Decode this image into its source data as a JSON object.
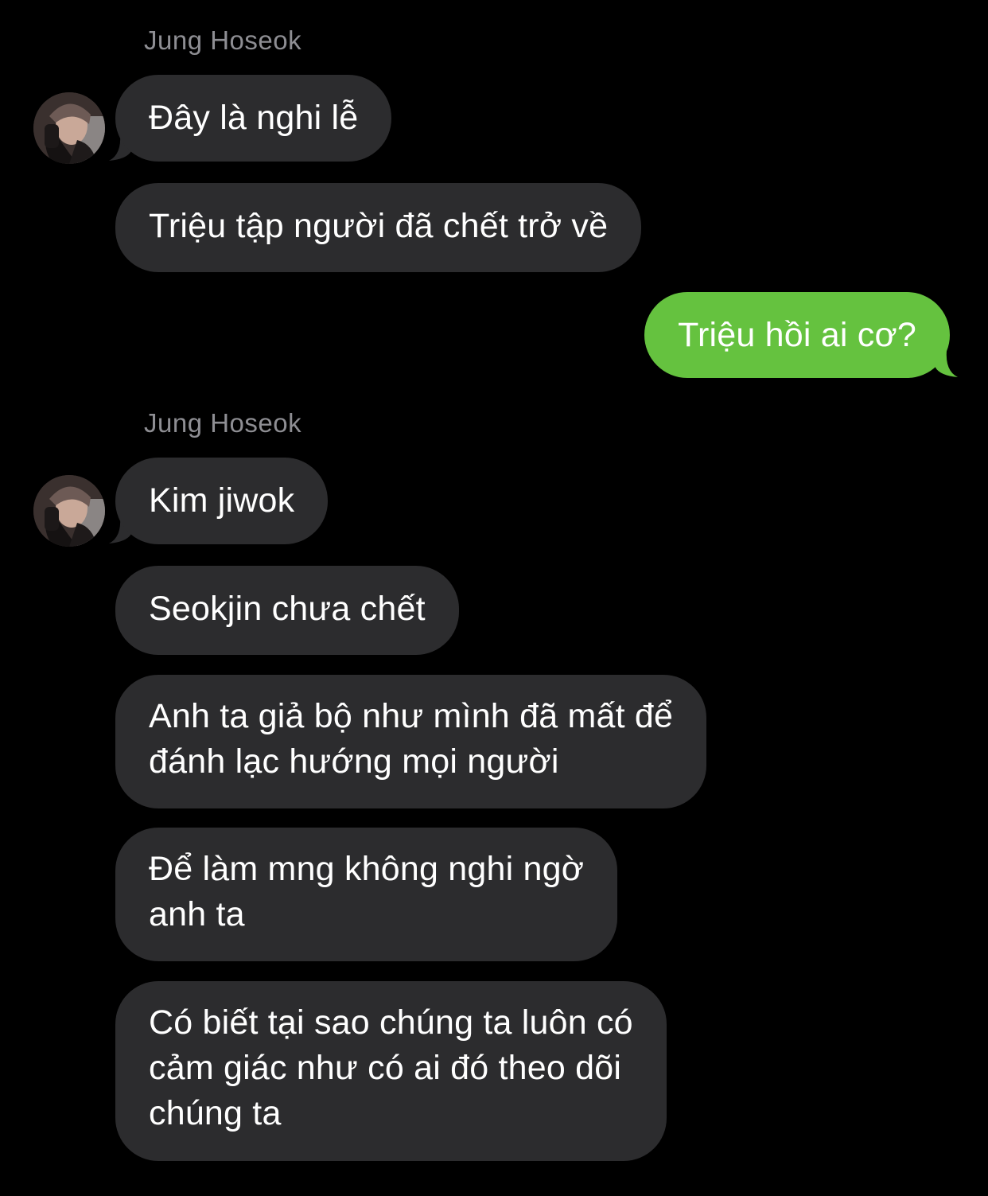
{
  "colors": {
    "background": "#000000",
    "incoming_bubble": "#2c2c2e",
    "outgoing_bubble": "#65c23f",
    "sender_name": "#8e8e93",
    "text": "#ffffff"
  },
  "groups": [
    {
      "sender": "Jung Hoseok",
      "messages": [
        {
          "text": "Đây là nghi lễ"
        },
        {
          "text": "Triệu tập người đã chết trở về"
        }
      ]
    },
    {
      "outgoing": [
        {
          "text": "Triệu hồi ai cơ?"
        }
      ]
    },
    {
      "sender": "Jung Hoseok",
      "messages": [
        {
          "text": "Kim jiwok"
        },
        {
          "text": "Seokjin chưa chết"
        },
        {
          "line1": "Anh ta giả bộ như mình đã mất để",
          "line2": "đánh lạc hướng mọi người"
        },
        {
          "line1": "Để làm mng không nghi ngờ",
          "line2": "anh ta"
        },
        {
          "line1": "Có biết tại sao chúng ta luôn có",
          "line2": "cảm giác như có ai đó theo dõi",
          "line3": "chúng ta"
        }
      ]
    }
  ],
  "icons": {
    "avatar": "profile-photo-avatar"
  }
}
